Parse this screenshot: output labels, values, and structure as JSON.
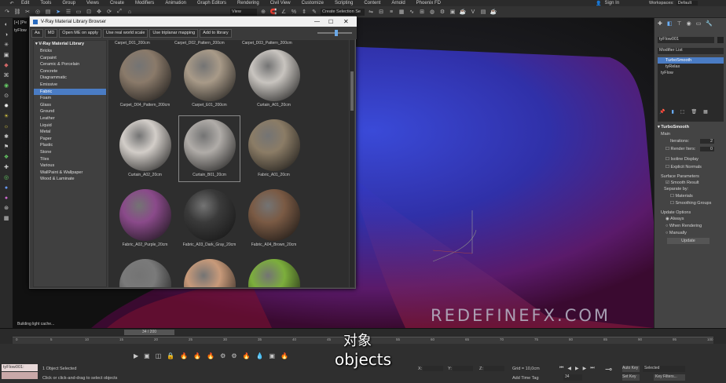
{
  "menu": [
    "Edit",
    "Tools",
    "Group",
    "Views",
    "Create",
    "Modifiers",
    "Animation",
    "Graph Editors",
    "Rendering",
    "Civil View",
    "Customize",
    "Scripting",
    "Content",
    "Arnold",
    "Phoenix FD"
  ],
  "account": {
    "signin": "Sign In",
    "workspaces_label": "Workspaces:",
    "workspace_value": "Default"
  },
  "toolbar": {
    "view_select": "View",
    "selection_set": "Create Selection Se"
  },
  "viewport": {
    "label": "[+] [Pe",
    "sublabel": "tyFlow",
    "watermark": "REDEFINEFX.COM"
  },
  "dialog": {
    "title": "V-Ray Material Library Browser",
    "buttons": [
      "Aa",
      "MD",
      "Open ME on apply",
      "Use real world scale",
      "Use triplanar mapping",
      "Add to library"
    ],
    "tree_root": "V-Ray Material Library",
    "categories": [
      "Bricks",
      "Carpaint",
      "Ceramic & Porcelain",
      "Concrete",
      "Diagrammatic",
      "Emissive",
      "Fabric",
      "Foam",
      "Glass",
      "Ground",
      "Leather",
      "Liquid",
      "Metal",
      "Paper",
      "Plastic",
      "Stone",
      "Tiles",
      "Various",
      "WallPaint & Wallpaper",
      "Wood & Laminate"
    ],
    "selected_category": "Fabric",
    "top_row_captions": [
      "Carpet_D01_200cm",
      "Carpet_D02_Pattern_200cm",
      "Carpet_D03_Pattern_200cm"
    ],
    "materials": [
      {
        "name": "Carpet_D04_Pattern_200cm",
        "color": "#8a7a6a"
      },
      {
        "name": "Carpet_E01_200cm",
        "color": "#a89a88"
      },
      {
        "name": "Curtain_A01_20cm",
        "color": "#c8c4bf"
      },
      {
        "name": "Curtain_A02_20cm",
        "color": "#d2cdc8"
      },
      {
        "name": "Curtain_B01_20cm",
        "color": "#b0aca8"
      },
      {
        "name": "Fabric_A01_20cm",
        "color": "#8b7c66"
      },
      {
        "name": "Fabric_A02_Purple_20cm",
        "color": "#8a4a8a"
      },
      {
        "name": "Fabric_A03_Dark_Gray_20cm",
        "color": "#3a3a3a"
      },
      {
        "name": "Fabric_A04_Brown_20cm",
        "color": "#7a5a44"
      },
      {
        "name": "",
        "color": "#7a7a7a"
      },
      {
        "name": "",
        "color": "#c89a7a"
      },
      {
        "name": "",
        "color": "#7cae3c"
      }
    ]
  },
  "status": {
    "building": "Building light cache..."
  },
  "rightpanel": {
    "object_name": "tyFlow001",
    "modifier_list": "Modifier List",
    "stack": [
      "TurboSmooth",
      "tyRelax",
      "tyFlow"
    ],
    "rollout_title": "TurboSmooth",
    "main_label": "Main",
    "iterations_label": "Iterations:",
    "iterations_value": "2",
    "render_iters_label": "Render Iters:",
    "render_iters_value": "0",
    "isoline": "Isoline Display",
    "explicit": "Explicit Normals",
    "surface_params": "Surface Parameters",
    "smooth_result": "Smooth Result",
    "separate_by": "Separate by:",
    "materials": "Materials",
    "smoothing_groups": "Smoothing Groups",
    "update_options": "Update Options",
    "always": "Always",
    "when_rendering": "When Rendering",
    "manually": "Manually",
    "update_btn": "Update"
  },
  "timeline": {
    "frame": "34 / 200",
    "start": "0",
    "ticks": [
      "0",
      "5",
      "10",
      "15",
      "20",
      "25",
      "30",
      "35",
      "40",
      "45",
      "50",
      "55",
      "60",
      "65",
      "70",
      "75",
      "80",
      "85",
      "90",
      "95",
      "100"
    ]
  },
  "bottom": {
    "script": "tyFlow001:",
    "selected": "1 Object Selected",
    "hint": "Click or click-and-drag to select objects",
    "x_label": "X:",
    "x_val": "",
    "y_label": "Y:",
    "y_val": "",
    "z_label": "Z:",
    "z_val": "",
    "grid": "Grid = 10,0cm",
    "add_time_tag": "Add Time Tag",
    "auto_key": "Auto Key",
    "set_key": "Set Key",
    "selected_dd": "Selected",
    "key_filters": "Key Filters...",
    "frame_field": "34"
  },
  "subtitles": {
    "zh": "对象",
    "en": "objects"
  }
}
